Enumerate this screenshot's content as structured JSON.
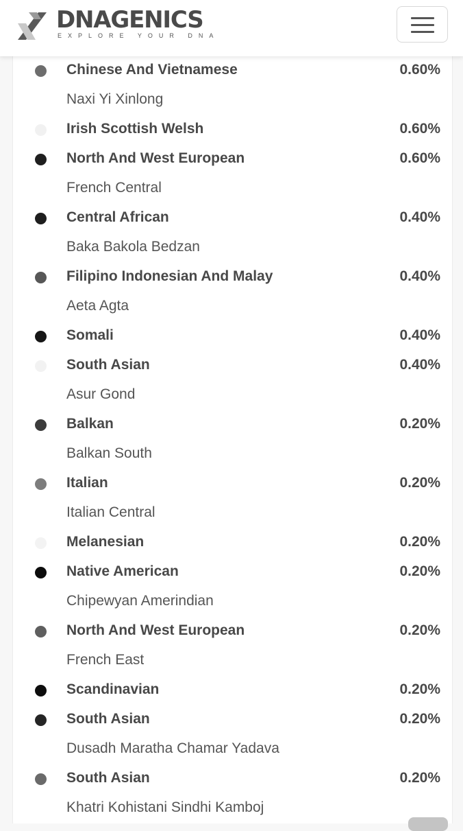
{
  "header": {
    "brand_name": "DNAGENICS",
    "tagline": "EXPLORE YOUR DNA",
    "logo_icon": "dnagenics-logo-mark",
    "menu_icon": "hamburger-menu-icon"
  },
  "rows": [
    {
      "type": "region",
      "label": "Chinese And Vietnamese",
      "percent": "0.60%",
      "dot_color": "#6d6d6d"
    },
    {
      "type": "sub",
      "label": "Naxi Yi Xinlong"
    },
    {
      "type": "region",
      "label": "Irish Scottish Welsh",
      "percent": "0.60%",
      "dot_color": "#f1f1f1"
    },
    {
      "type": "region",
      "label": "North And West European",
      "percent": "0.60%",
      "dot_color": "#1f1f1f"
    },
    {
      "type": "sub",
      "label": "French Central"
    },
    {
      "type": "region",
      "label": "Central African",
      "percent": "0.40%",
      "dot_color": "#1e1e1e"
    },
    {
      "type": "sub",
      "label": "Baka Bakola Bedzan"
    },
    {
      "type": "region",
      "label": "Filipino Indonesian And Malay",
      "percent": "0.40%",
      "dot_color": "#575757"
    },
    {
      "type": "sub",
      "label": "Aeta Agta"
    },
    {
      "type": "region",
      "label": "Somali",
      "percent": "0.40%",
      "dot_color": "#161616"
    },
    {
      "type": "region",
      "label": "South Asian",
      "percent": "0.40%",
      "dot_color": "#f2f2f2"
    },
    {
      "type": "sub",
      "label": "Asur Gond"
    },
    {
      "type": "region",
      "label": "Balkan",
      "percent": "0.20%",
      "dot_color": "#3c3c3c"
    },
    {
      "type": "sub",
      "label": "Balkan South"
    },
    {
      "type": "region",
      "label": "Italian",
      "percent": "0.20%",
      "dot_color": "#7d7d7d"
    },
    {
      "type": "sub",
      "label": "Italian Central"
    },
    {
      "type": "region",
      "label": "Melanesian",
      "percent": "0.20%",
      "dot_color": "#f3f3f3"
    },
    {
      "type": "region",
      "label": "Native American",
      "percent": "0.20%",
      "dot_color": "#0c0c0c"
    },
    {
      "type": "sub",
      "label": "Chipewyan Amerindian"
    },
    {
      "type": "region",
      "label": "North And West European",
      "percent": "0.20%",
      "dot_color": "#5f5f5f"
    },
    {
      "type": "sub",
      "label": "French East"
    },
    {
      "type": "region",
      "label": "Scandinavian",
      "percent": "0.20%",
      "dot_color": "#0d0d0d"
    },
    {
      "type": "region",
      "label": "South Asian",
      "percent": "0.20%",
      "dot_color": "#252525"
    },
    {
      "type": "sub",
      "label": "Dusadh Maratha Chamar Yadava"
    },
    {
      "type": "region",
      "label": "South Asian",
      "percent": "0.20%",
      "dot_color": "#6a6a6a"
    },
    {
      "type": "sub",
      "label": "Khatri Kohistani Sindhi Kamboj"
    }
  ]
}
